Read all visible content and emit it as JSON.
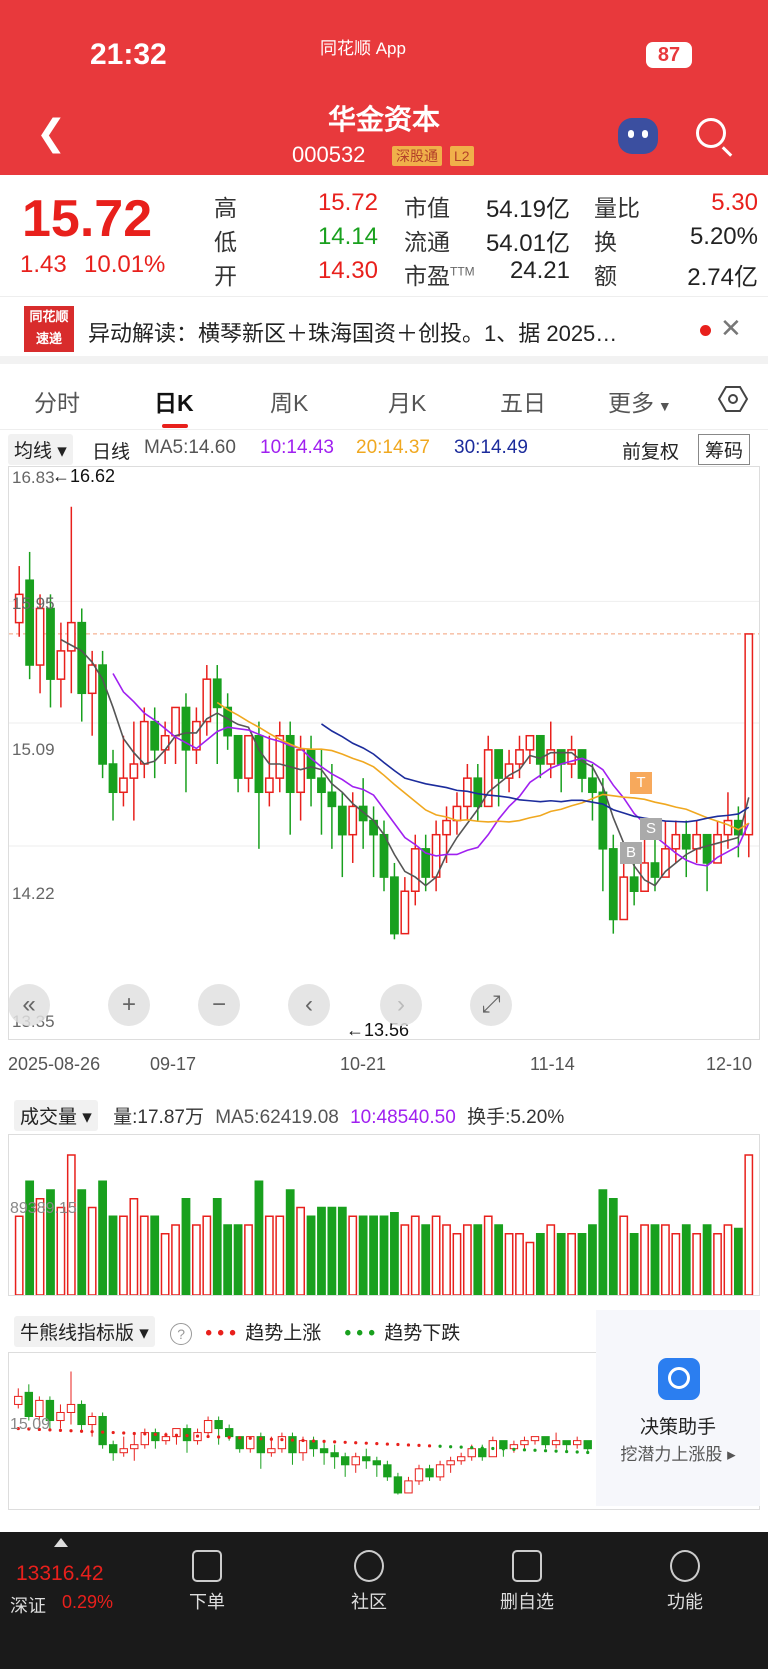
{
  "status": {
    "time": "21:32",
    "app": "同花顺 App",
    "battery": "87"
  },
  "header": {
    "title": "华金资本",
    "code": "000532",
    "tag1": "深股通",
    "tag2": "L2"
  },
  "quote": {
    "price": "15.72",
    "change": "1.43",
    "change_pct": "10.01%",
    "labels": {
      "high": "高",
      "low": "低",
      "open": "开",
      "mcap": "市值",
      "float": "流通",
      "pe": "市盈",
      "pe_sup": "TTM",
      "vr": "量比",
      "turn": "换",
      "amt": "额"
    },
    "high": "15.72",
    "low": "14.14",
    "open": "14.30",
    "mcap": "54.19亿",
    "float": "54.01亿",
    "pe": "24.21",
    "vr": "5.30",
    "turn": "5.20%",
    "amt": "2.74亿"
  },
  "news": {
    "logo_top": "同花顺",
    "logo_bottom": "速递",
    "text": "异动解读：横琴新区＋珠海国资＋创投。1、据 2025…"
  },
  "tabs": [
    "分时",
    "日K",
    "周K",
    "月K",
    "五日",
    "更多"
  ],
  "legend": {
    "dropdown": "均线",
    "period": "日线",
    "ma5": "MA5:14.60",
    "ma10": "10:14.43",
    "ma20": "20:14.37",
    "ma30": "30:14.49",
    "adjust": "前复权",
    "chips": "筹码"
  },
  "colors": {
    "up": "#e8201c",
    "down": "#19a01e",
    "ma5": "#555555",
    "ma10": "#a020f0",
    "ma20": "#f0a820",
    "ma30": "#1c2c9c",
    "accent": "#e8393c"
  },
  "price_axis": {
    "top": "16.83",
    "t2": "15.95",
    "t3": "15.09",
    "t4": "14.22",
    "bottom": "13.35"
  },
  "markers": {
    "max": "←16.62",
    "min": "←13.56",
    "t": "T",
    "b": "B",
    "s": "S"
  },
  "dates": [
    "2025-08-26",
    "09-17",
    "10-21",
    "11-14",
    "12-10"
  ],
  "volume": {
    "dropdown": "成交量",
    "vol": "量:17.87万",
    "ma5": "MA5:62419.08",
    "ma10": "10:48540.50",
    "turnover": "换手:5.20%",
    "axis": "89389.15"
  },
  "bull": {
    "dropdown": "牛熊线指标版",
    "help": "?",
    "up_mark": "• • •",
    "up": "趋势上涨",
    "down_mark": "• • •",
    "down": "趋势下跌",
    "axis": "15.09"
  },
  "assistant": {
    "title": "决策助手",
    "sub": "挖潜力上涨股"
  },
  "bottom": {
    "index": "13316.42",
    "index_name": "深证",
    "index_chg": "0.29%",
    "items": [
      "下单",
      "社区",
      "删自选",
      "功能"
    ]
  },
  "chart_data": {
    "type": "candlestick",
    "title": "",
    "x_range": [
      "2025-08-26",
      "12-10"
    ],
    "ylim": [
      13.35,
      16.83
    ],
    "ticks": [
      16.83,
      15.95,
      15.09,
      14.22,
      13.35
    ],
    "candles": [
      [
        15.8,
        16.0,
        15.7,
        16.2
      ],
      [
        16.1,
        15.5,
        15.4,
        16.3
      ],
      [
        15.5,
        15.9,
        15.3,
        16.0
      ],
      [
        15.9,
        15.4,
        15.2,
        16.0
      ],
      [
        15.4,
        15.6,
        15.2,
        15.8
      ],
      [
        15.6,
        15.8,
        15.3,
        16.62
      ],
      [
        15.8,
        15.3,
        15.1,
        15.9
      ],
      [
        15.3,
        15.5,
        15.0,
        15.6
      ],
      [
        15.5,
        14.8,
        14.7,
        15.6
      ],
      [
        14.8,
        14.6,
        14.4,
        14.9
      ],
      [
        14.6,
        14.7,
        14.5,
        15.0
      ],
      [
        14.7,
        14.8,
        14.4,
        15.1
      ],
      [
        14.8,
        15.1,
        14.7,
        15.2
      ],
      [
        15.1,
        14.9,
        14.7,
        15.2
      ],
      [
        14.9,
        15.0,
        14.8,
        15.1
      ],
      [
        15.0,
        15.2,
        14.8,
        15.2
      ],
      [
        15.2,
        14.9,
        14.6,
        15.3
      ],
      [
        14.9,
        15.1,
        14.8,
        15.2
      ],
      [
        15.1,
        15.4,
        15.0,
        15.5
      ],
      [
        15.4,
        15.2,
        14.8,
        15.5
      ],
      [
        15.2,
        15.0,
        14.9,
        15.3
      ],
      [
        15.0,
        14.7,
        14.6,
        15.0
      ],
      [
        14.7,
        15.0,
        14.6,
        15.0
      ],
      [
        15.0,
        14.6,
        14.2,
        15.1
      ],
      [
        14.6,
        14.7,
        14.5,
        15.0
      ],
      [
        14.7,
        15.0,
        14.6,
        15.1
      ],
      [
        15.0,
        14.6,
        14.3,
        15.1
      ],
      [
        14.6,
        14.9,
        14.4,
        15.0
      ],
      [
        14.9,
        14.7,
        14.5,
        15.0
      ],
      [
        14.7,
        14.6,
        14.3,
        14.9
      ],
      [
        14.6,
        14.5,
        14.2,
        14.8
      ],
      [
        14.5,
        14.3,
        14.0,
        14.6
      ],
      [
        14.3,
        14.5,
        14.1,
        14.6
      ],
      [
        14.5,
        14.4,
        14.2,
        14.7
      ],
      [
        14.4,
        14.3,
        14.0,
        14.5
      ],
      [
        14.3,
        14.0,
        13.9,
        14.4
      ],
      [
        14.0,
        13.6,
        13.56,
        14.1
      ],
      [
        13.6,
        13.9,
        13.6,
        14.0
      ],
      [
        13.9,
        14.2,
        13.8,
        14.3
      ],
      [
        14.2,
        14.0,
        13.9,
        14.3
      ],
      [
        14.0,
        14.3,
        13.9,
        14.4
      ],
      [
        14.3,
        14.4,
        14.1,
        14.5
      ],
      [
        14.4,
        14.5,
        14.3,
        14.6
      ],
      [
        14.5,
        14.7,
        14.4,
        14.8
      ],
      [
        14.7,
        14.5,
        14.4,
        14.8
      ],
      [
        14.5,
        14.9,
        14.5,
        15.0
      ],
      [
        14.9,
        14.7,
        14.5,
        14.9
      ],
      [
        14.7,
        14.8,
        14.6,
        14.9
      ],
      [
        14.8,
        14.9,
        14.7,
        15.0
      ],
      [
        14.9,
        15.0,
        14.8,
        15.0
      ],
      [
        15.0,
        14.8,
        14.7,
        15.0
      ],
      [
        14.8,
        14.9,
        14.7,
        15.1
      ],
      [
        14.9,
        14.8,
        14.6,
        14.9
      ],
      [
        14.8,
        14.9,
        14.7,
        15.0
      ],
      [
        14.9,
        14.7,
        14.6,
        14.9
      ],
      [
        14.7,
        14.6,
        14.4,
        14.8
      ],
      [
        14.6,
        14.2,
        13.9,
        14.7
      ],
      [
        14.2,
        13.7,
        13.6,
        14.3
      ],
      [
        13.7,
        14.0,
        13.7,
        14.2
      ],
      [
        14.0,
        13.9,
        13.8,
        14.1
      ],
      [
        13.9,
        14.1,
        13.9,
        14.3
      ],
      [
        14.1,
        14.0,
        13.9,
        14.3
      ],
      [
        14.0,
        14.2,
        14.0,
        14.4
      ],
      [
        14.2,
        14.3,
        14.1,
        14.4
      ],
      [
        14.3,
        14.2,
        14.0,
        14.4
      ],
      [
        14.2,
        14.3,
        14.1,
        14.4
      ],
      [
        14.3,
        14.1,
        13.9,
        14.3
      ],
      [
        14.1,
        14.3,
        14.1,
        14.4
      ],
      [
        14.3,
        14.4,
        14.2,
        14.6
      ],
      [
        14.4,
        14.3,
        14.14,
        14.5
      ],
      [
        14.3,
        15.72,
        14.14,
        15.72
      ]
    ]
  }
}
